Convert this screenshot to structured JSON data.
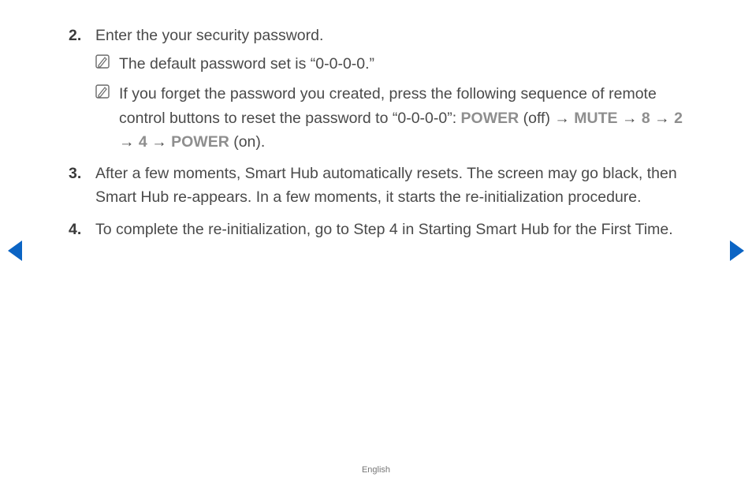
{
  "steps": {
    "s2": {
      "num": "2.",
      "text": "Enter the your security password.",
      "note1": "The default password set is “0-0-0-0.”",
      "note2_pre": "If you forget the password you created, press the following sequence of remote control buttons to reset the password to “0-0-0-0”: ",
      "kw_power_off": "POWER",
      "off_txt": " (off) ",
      "arr": "→",
      "kw_mute": "MUTE",
      "kw_8": "8",
      "kw_2": "2",
      "kw_4": "4",
      "kw_power_on": "POWER",
      "on_txt": " (on)."
    },
    "s3": {
      "num": "3.",
      "text": "After a few moments, Smart Hub automatically resets. The screen may go black, then Smart Hub re-appears. In a few moments, it starts the re-initialization procedure."
    },
    "s4": {
      "num": "4.",
      "text": "To complete the re-initialization, go to Step 4 in Starting Smart Hub for the First Time."
    }
  },
  "footer": "English"
}
